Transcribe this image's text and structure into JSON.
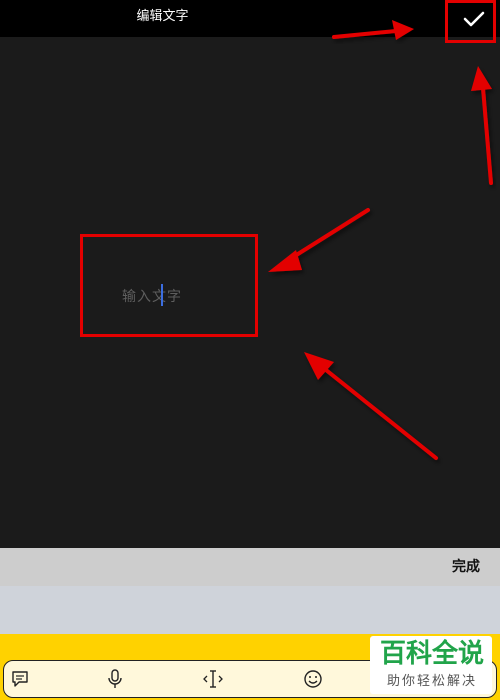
{
  "header": {
    "title": "编辑文字"
  },
  "editor": {
    "placeholder": "输入文字"
  },
  "done_bar": {
    "done_label": "完成"
  },
  "toolbar": {
    "icons": [
      "comment-icon",
      "microphone-icon",
      "text-cursor-icon",
      "emoji-icon"
    ]
  },
  "watermark": {
    "title": "百科全说",
    "subtitle": "助你轻松解决"
  },
  "colors": {
    "annotation": "#e30000",
    "caret": "#3b6de0",
    "keyboard_accent": "#ffd200",
    "watermark_green": "#21a44a"
  }
}
